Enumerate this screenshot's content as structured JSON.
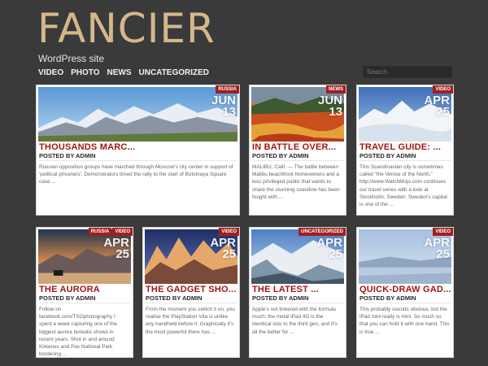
{
  "site": {
    "title": "FANCIER",
    "description": "WordPress site"
  },
  "nav": [
    "VIDEO",
    "PHOTO",
    "NEWS",
    "UNCATEGORIZED"
  ],
  "search": {
    "placeholder": "Search"
  },
  "colors": {
    "background": "#3a3a3a",
    "title": "#d4b78c",
    "accent": "#a02020",
    "post_title": "#a01616"
  },
  "posts": [
    {
      "title": "THOUSANDS MARC...",
      "by": "POSTED BY ADMIN",
      "tags": [
        "RUSSIA"
      ],
      "month": "JUN",
      "day": "13",
      "excerpt": "Russian opposition groups have marched through Moscow's city center in support of 'political prisoners'. Demonstrators timed the rally to the start of Bolotnaya Square case ..."
    },
    {
      "title": "IN BATTLE OVER...",
      "by": "POSTED BY ADMIN",
      "tags": [
        "NEWS"
      ],
      "month": "JUN",
      "day": "13",
      "excerpt": "MALIBU, Calif. — The battle between Malibu beachfront homeowners and a less privileged public that wants to share the stunning coastline has been fought with ..."
    },
    {
      "title": "TRAVEL GUIDE: ...",
      "by": "POSTED BY ADMIN",
      "tags": [
        "VIDEO"
      ],
      "month": "APR",
      "day": "25",
      "excerpt": "This Scandinavian city is sometimes called \"the Venice of the North.\" http://www.WatchMojo.com continues our travel series with a look at Stockholm, Sweden. Sweden's capital is one of the ..."
    },
    {
      "title": "THE AURORA",
      "by": "POSTED BY ADMIN",
      "tags": [
        "RUSSIA",
        "VIDEO"
      ],
      "month": "APR",
      "day": "25",
      "excerpt": "Follow on facebook.com/TSOphotography I spent a week capturing one of the biggest aurora borealis shows in recent years. Shot in and around Kirkenes and Pas National Park bordering ..."
    },
    {
      "title": "THE GADGET SHO...",
      "by": "POSTED BY ADMIN",
      "tags": [
        "VIDEO"
      ],
      "month": "APR",
      "day": "25",
      "excerpt": "From the moment you switch it on, you realise the PlayStation Vita is unlike any handheld before it. Graphically it's the most powerful there has ..."
    },
    {
      "title": "THE LATEST ...",
      "by": "POSTED BY ADMIN",
      "tags": [
        "UNCATEGORIZED"
      ],
      "month": "APR",
      "day": "25",
      "excerpt": "Apple's not tinkered with the formula much: the metal iPad 4G is the identical size to the third gen, and it's all the better for ..."
    },
    {
      "title": "QUICK-DRAW GAD...",
      "by": "POSTED BY ADMIN",
      "tags": [
        "VIDEO"
      ],
      "month": "APR",
      "day": "25",
      "excerpt": "This probably sounds obvious, but the iPad mini really is mini. So much so that you can hold it with one hand. This is true ..."
    }
  ]
}
